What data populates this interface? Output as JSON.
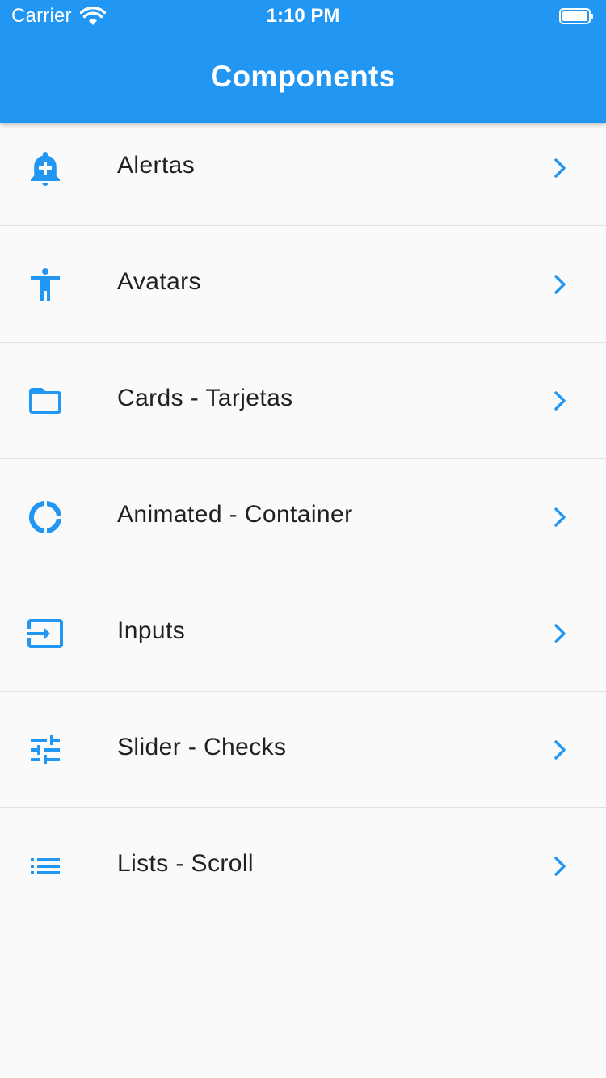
{
  "status_bar": {
    "carrier": "Carrier",
    "time": "1:10 PM"
  },
  "app_bar": {
    "title": "Components",
    "color": "#2196f3"
  },
  "items": [
    {
      "label": "Alertas",
      "icon": "add-alert-icon"
    },
    {
      "label": "Avatars",
      "icon": "accessibility-icon"
    },
    {
      "label": "Cards - Tarjetas",
      "icon": "folder-open-icon"
    },
    {
      "label": "Animated - Container",
      "icon": "donut-large-icon"
    },
    {
      "label": "Inputs",
      "icon": "input-icon"
    },
    {
      "label": "Slider - Checks",
      "icon": "tune-icon"
    },
    {
      "label": "Lists - Scroll",
      "icon": "list-icon"
    }
  ],
  "colors": {
    "accent": "#2196f3",
    "background": "#fafafa",
    "divider": "#e0e0e0",
    "text": "#212121"
  }
}
